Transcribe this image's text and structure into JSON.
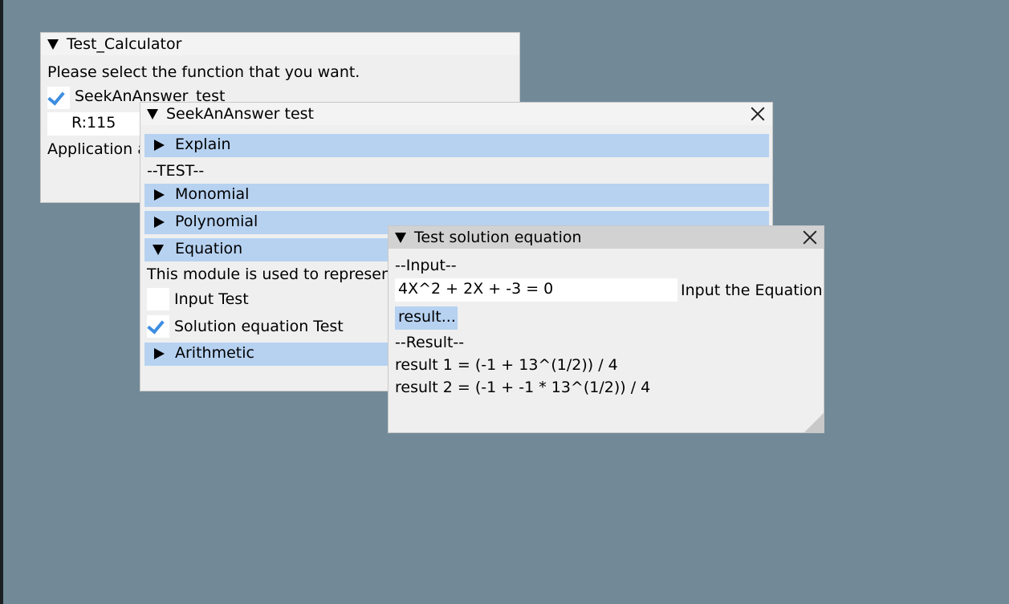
{
  "calculator_window": {
    "title": "Test_Calculator",
    "prompt": "Please select the function that you want.",
    "checkbox_label": "SeekAnAnswer_test",
    "checkbox_checked": true,
    "field_value": "R:115",
    "status_text": "Application a"
  },
  "seek_window": {
    "title": "SeekAnAnswer test",
    "sections": {
      "explain": "Explain",
      "test_label": "--TEST--",
      "monomial": "Monomial",
      "polynomial": "Polynomial",
      "equation": "Equation",
      "equation_desc": "This module is used to represent",
      "input_test": "Input Test",
      "input_test_checked": false,
      "solution_test": "Solution equation Test",
      "solution_test_checked": true,
      "arithmetic": "Arithmetic"
    }
  },
  "solution_window": {
    "title": "Test solution equation",
    "input_label": "--Input--",
    "equation_value": "4X^2 + 2X + -3 = 0",
    "equation_hint": "Input the Equation",
    "result_button": "result...",
    "result_label": "--Result--",
    "results": [
      "result 1 = (-1 + 13^(1/2)) / 4",
      "result 2 = (-1 + -1 * 13^(1/2)) / 4"
    ]
  },
  "colors": {
    "desktop": "#728a98",
    "window_bg": "#efefef",
    "header_highlight": "#b7d2f1",
    "check_accent": "#3d8ee0"
  }
}
